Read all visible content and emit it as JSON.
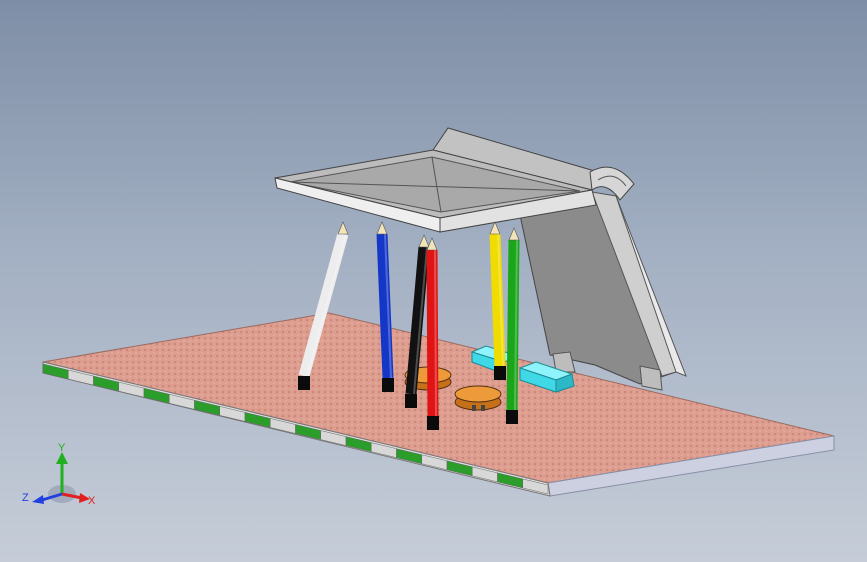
{
  "viewport": {
    "background_top": "#7e8ea6",
    "background_bottom": "#c6cdd8"
  },
  "model": {
    "base_color": "#d9988a",
    "edge_colors": [
      "#2a9d2a",
      "#d8d8d8"
    ],
    "roof_color": "#bfbfbf",
    "panel_color": "#8e8e8e",
    "pencil_colors": [
      "#ededed",
      "#1537c8",
      "#111111",
      "#e01414",
      "#f0dc00",
      "#1aa51a"
    ],
    "seat_color": "#e08a1c",
    "block_color": "#3fe0ee"
  },
  "triad": {
    "x_label": "X",
    "y_label": "Y",
    "z_label": "Z",
    "x_color": "#e02020",
    "y_color": "#20b020",
    "z_color": "#2040e0"
  }
}
